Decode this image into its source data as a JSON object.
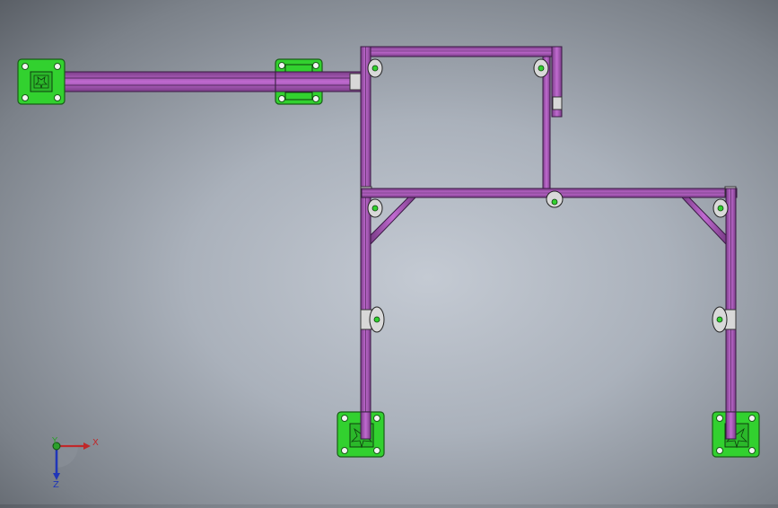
{
  "triad": {
    "x_label": "X",
    "y_label": "Y",
    "z_label": "Z"
  },
  "colors": {
    "frame": "#b15bc0",
    "frame_dark": "#6a2a78",
    "base_plate": "#32d12f",
    "base_plate_dark": "#1d7a1a",
    "axis_x": "#c0282a",
    "axis_y": "#2ca02c",
    "axis_z": "#2036b8"
  }
}
